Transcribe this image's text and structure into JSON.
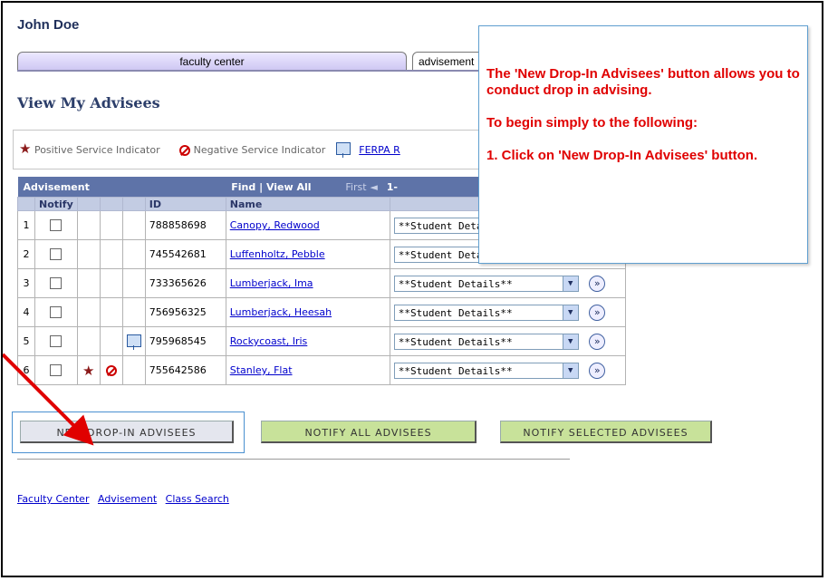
{
  "user": {
    "name": "John Doe"
  },
  "tabs": [
    {
      "label": "faculty center"
    },
    {
      "label": "advisement"
    }
  ],
  "page_title": "View My Advisees",
  "legend": {
    "positive": "Positive Service Indicator",
    "negative": "Negative Service Indicator",
    "ferpa": "FERPA R"
  },
  "grid": {
    "caption": "Advisement",
    "find": "Find",
    "view_all": "View All",
    "first": "First",
    "range": "1-",
    "columns": {
      "notify": "Notify",
      "id": "ID",
      "name": "Name"
    },
    "rows": [
      {
        "num": "1",
        "id": "788858698",
        "name": "Canopy, Redwood",
        "select": "**Student Details**",
        "ferpa": false,
        "positive": false,
        "negative": false
      },
      {
        "num": "2",
        "id": "745542681",
        "name": "Luffenholtz, Pebble",
        "select": "**Student Details**",
        "ferpa": false,
        "positive": false,
        "negative": false
      },
      {
        "num": "3",
        "id": "733365626",
        "name": "Lumberjack, Ima",
        "select": "**Student Details**",
        "ferpa": false,
        "positive": false,
        "negative": false
      },
      {
        "num": "4",
        "id": "756956325",
        "name": "Lumberjack, Heesah",
        "select": "**Student Details**",
        "ferpa": false,
        "positive": false,
        "negative": false
      },
      {
        "num": "5",
        "id": "795968545",
        "name": "Rockycoast, Iris",
        "select": "**Student Details**",
        "ferpa": true,
        "positive": false,
        "negative": false
      },
      {
        "num": "6",
        "id": "755642586",
        "name": "Stanley, Flat",
        "select": "**Student Details**",
        "ferpa": false,
        "positive": true,
        "negative": true
      }
    ]
  },
  "buttons": {
    "new_drop_in": "NEW DROP-IN ADVISEES",
    "notify_all": "NOTIFY ALL ADVISEES",
    "notify_selected": "NOTIFY SELECTED ADVISEES"
  },
  "footer": {
    "links": [
      "Faculty Center",
      "Advisement",
      "Class Search"
    ]
  },
  "callout": {
    "line1": "The 'New Drop-In Advisees' button allows you to conduct drop in advising.",
    "line2": "To begin simply to the following:",
    "step1": "1. Click on 'New Drop-In Advisees' button."
  },
  "colors": {
    "callout_text": "#e00000",
    "arrow": "#e00000",
    "grid_header": "#5e73a8"
  }
}
